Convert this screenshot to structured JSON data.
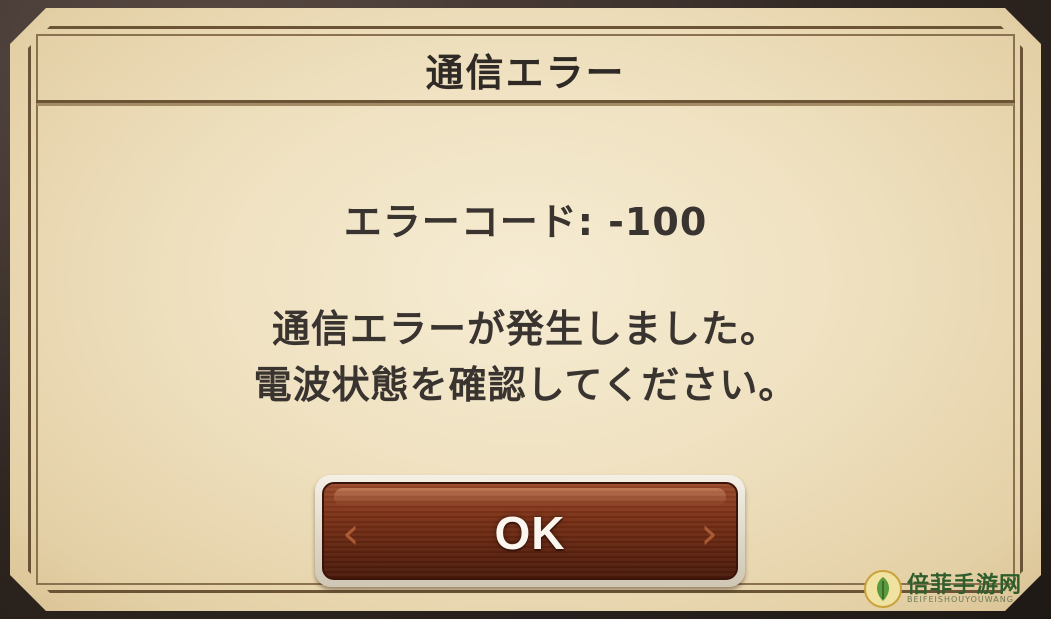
{
  "dialog": {
    "title": "通信エラー",
    "error_code_text": "エラーコード: -100",
    "message_line1": "通信エラーが発生しました。",
    "message_line2": "電波状態を確認してください。",
    "ok_label": "OK"
  },
  "watermark": {
    "text": "倍菲手游网",
    "sub": "BEIFEISHOUYOUWANG"
  },
  "colors": {
    "parchment": "#efe1c0",
    "frame": "#6b5436",
    "text": "#3a3430",
    "button": "#7a3016",
    "button_text": "#fbf6ee"
  }
}
